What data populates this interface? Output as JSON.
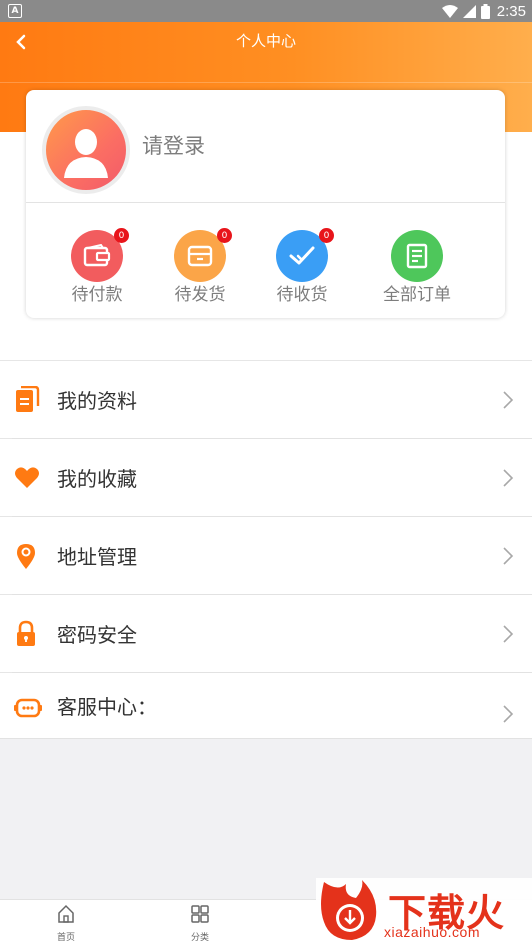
{
  "status_bar": {
    "time": "2:35"
  },
  "header": {
    "title": "个人中心"
  },
  "profile": {
    "login_text": "请登录"
  },
  "orders": [
    {
      "label": "待付款",
      "badge": "0",
      "color": "#f25c5e",
      "icon": "wallet-icon"
    },
    {
      "label": "待发货",
      "badge": "0",
      "color": "#fba548",
      "icon": "box-icon"
    },
    {
      "label": "待收货",
      "badge": "0",
      "color": "#3a9ef5",
      "icon": "check-icon"
    },
    {
      "label": "全部订单",
      "color": "#4ec75b",
      "icon": "document-icon"
    }
  ],
  "menu": [
    {
      "label": "我的资料",
      "icon": "profile-document-icon"
    },
    {
      "label": "我的收藏",
      "icon": "heart-icon"
    },
    {
      "label": "地址管理",
      "icon": "location-pin-icon"
    },
    {
      "label": "密码安全",
      "icon": "lock-icon"
    },
    {
      "label": "客服中心：",
      "icon": "chat-bubble-icon"
    }
  ],
  "tabs": [
    {
      "label": "首页",
      "icon": "home-icon"
    },
    {
      "label": "分类",
      "icon": "grid-icon"
    }
  ],
  "watermark": {
    "text": "下载火",
    "url": "xiazaihuo.com"
  },
  "colors": {
    "accent": "#ff7a12",
    "badge": "#e8151b"
  }
}
